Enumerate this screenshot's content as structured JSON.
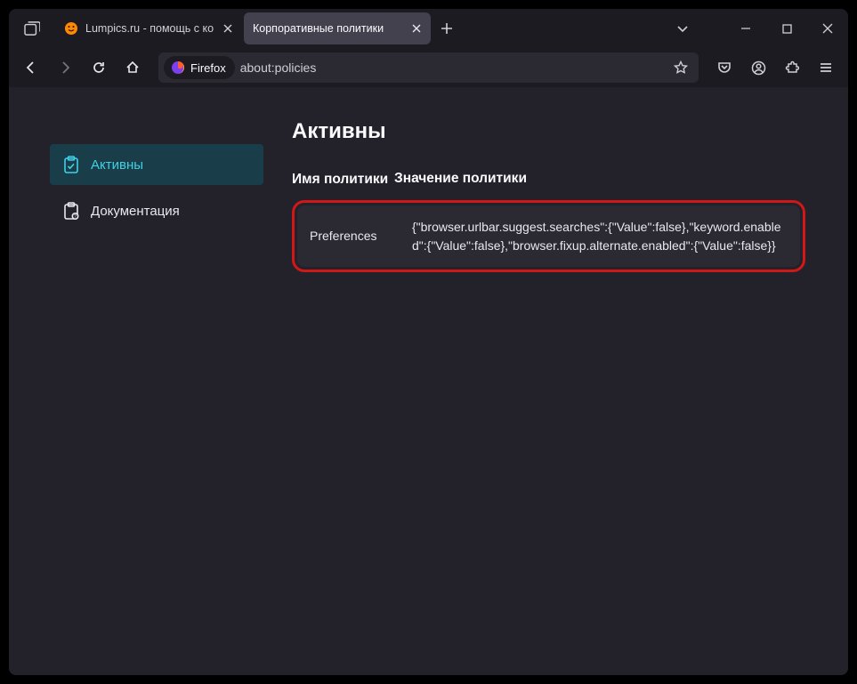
{
  "tabs": [
    {
      "label": "Lumpics.ru - помощь с компьютером",
      "icon": "lumpics"
    },
    {
      "label": "Корпоративные политики",
      "icon": "none"
    }
  ],
  "urlbar": {
    "pill_label": "Firefox",
    "text": "about:policies"
  },
  "sidebar": {
    "items": [
      {
        "id": "active",
        "label": "Активны"
      },
      {
        "id": "docs",
        "label": "Документация"
      }
    ]
  },
  "page": {
    "title": "Активны",
    "columns": {
      "name": "Имя политики",
      "value": "Значение политики"
    },
    "rows": [
      {
        "name": "Preferences",
        "value": "{\"browser.urlbar.suggest.searches\":{\"Value\":false},\"keyword.enabled\":{\"Value\":false},\"browser.fixup.alternate.enabled\":{\"Value\":false}}"
      }
    ]
  }
}
